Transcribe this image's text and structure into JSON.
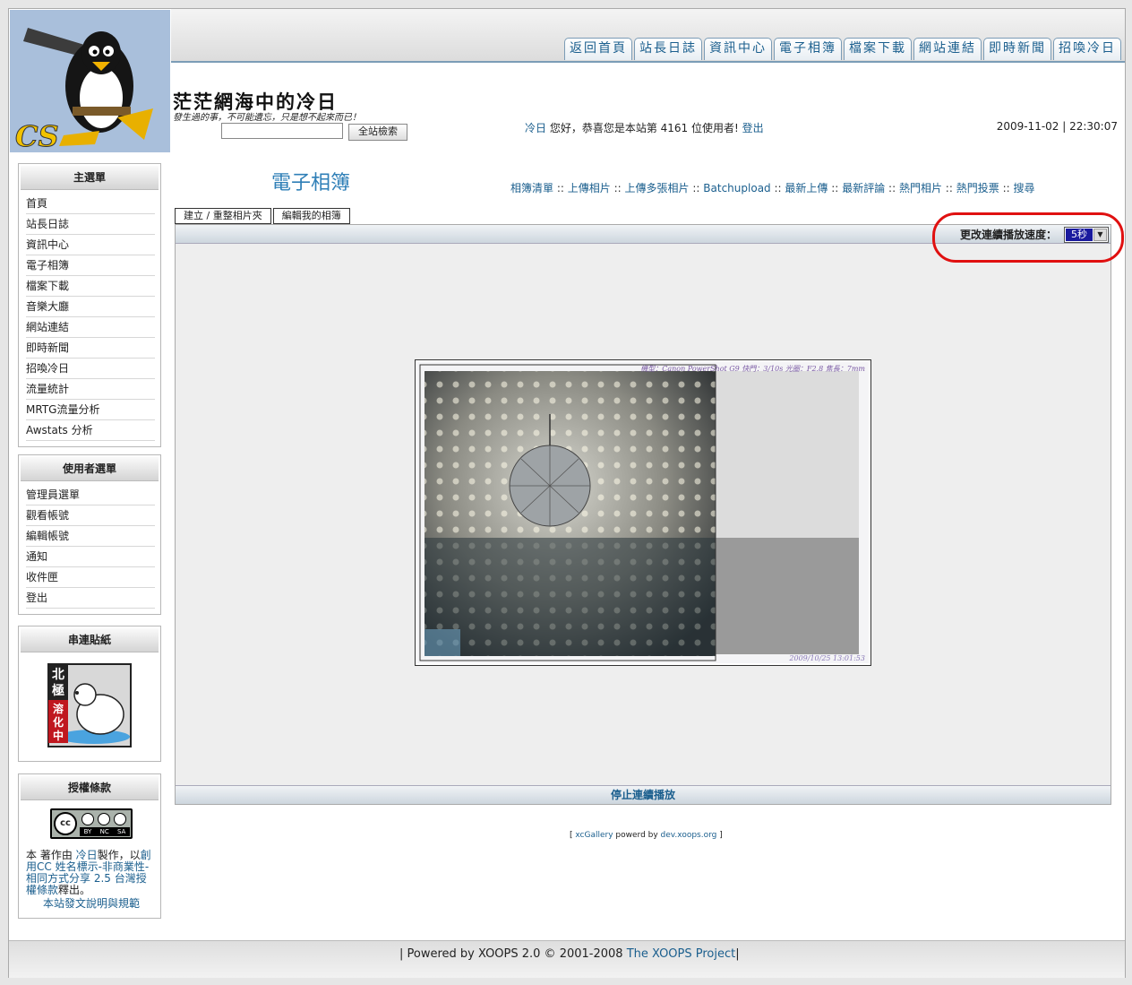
{
  "topnav": [
    "返回首頁",
    "站長日誌",
    "資訊中心",
    "電子相簿",
    "檔案下載",
    "網站連結",
    "即時新聞",
    "招喚冷日"
  ],
  "site": {
    "title": "茫茫網海中的冷日",
    "slogan": "發生過的事，不可能遺忘，只是想不起來而已！",
    "search_button": "全站檢索",
    "welcome_user": "冷日",
    "welcome_text": " 您好，恭喜您是本站第 4161 位使用者! ",
    "logout": "登出",
    "datetime": "2009-11-02 | 22:30:07"
  },
  "blocks": {
    "main": {
      "title": "主選單",
      "items": [
        "首頁",
        "站長日誌",
        "資訊中心",
        "電子相簿",
        "檔案下載",
        "音樂大廳",
        "網站連結",
        "即時新聞",
        "招喚冷日",
        "流量統計",
        "MRTG流量分析",
        "Awstats 分析"
      ]
    },
    "user": {
      "title": "使用者選單",
      "items": [
        "管理員選單",
        "觀看帳號",
        "編輯帳號",
        "通知",
        "收件匣",
        "登出"
      ]
    },
    "sticker": {
      "title": "串連貼紙",
      "image_text": [
        "北",
        "極",
        "溶",
        "化",
        "中"
      ]
    },
    "license": {
      "title": "授權條款",
      "badge": [
        "cc",
        "BY",
        "NC",
        "SA"
      ],
      "t1": "本 著作由 ",
      "author": "冷日",
      "t2": "製作，以",
      "license_link": "創用CC 姓名標示-非商業性-相同方式分享 2.5 台灣授權條款",
      "t3": "釋出。",
      "rules_link": "本站發文說明與規範"
    }
  },
  "gallery": {
    "title": "電子相簿",
    "nav": [
      "相簿清單",
      "上傳相片",
      "上傳多張相片",
      "Batchupload",
      "最新上傳",
      "最新評論",
      "熱門相片",
      "熱門投票",
      "搜尋"
    ],
    "nav_sep": "::",
    "tabs": [
      "建立 / 重整相片夾",
      "編輯我的相簿"
    ],
    "speed_label": "更改連續播放速度：",
    "speed_value": "5秒",
    "photo_meta": "機型：Canon PowerShot G9 快門：3/10s 光圈：F2.8 焦長：7mm",
    "photo_date": "2009/10/25 13:01:53",
    "stop_slideshow": "停止連續播放",
    "powered_open": "[ ",
    "powered_xc": "xcGallery",
    "powered_mid": " powerd by ",
    "powered_dev": "dev.xoops.org",
    "powered_close": " ]"
  },
  "footer": {
    "pre": "| Powered by XOOPS 2.0 © 2001-2008 ",
    "link": "The XOOPS Project",
    "post": "|"
  }
}
